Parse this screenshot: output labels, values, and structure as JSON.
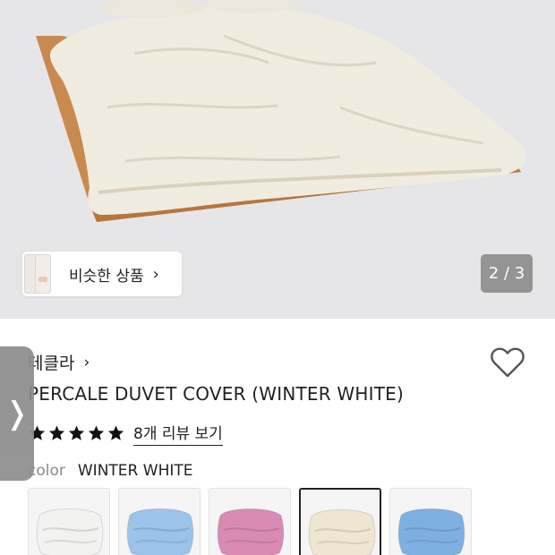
{
  "hero": {
    "similar_label": "비슷한 상품",
    "pager_text": "2 / 3"
  },
  "product": {
    "brand": "테클라",
    "title": "PERCALE DUVET COVER (WINTER WHITE)",
    "rating": 5,
    "review_link": "8개 리뷰 보기",
    "color_label": "color",
    "color_value": "WINTER WHITE",
    "swatches": [
      {
        "name": "white",
        "color": "#f2f2f0",
        "selected": false
      },
      {
        "name": "blue",
        "color": "#9cc3ea",
        "selected": false
      },
      {
        "name": "pink-stripe",
        "color": "#d98bb4",
        "selected": false
      },
      {
        "name": "winter-white",
        "color": "#efe6d2",
        "selected": true
      },
      {
        "name": "blue-stripe",
        "color": "#7fb0e2",
        "selected": false
      }
    ]
  },
  "icons": {
    "chevron": "›",
    "side_tab_arrow": "❭"
  },
  "colors": {
    "bed_frame": "#c98a4f",
    "duvet": "#f1ece0",
    "text": "#222222",
    "muted": "#8a8a8a"
  }
}
